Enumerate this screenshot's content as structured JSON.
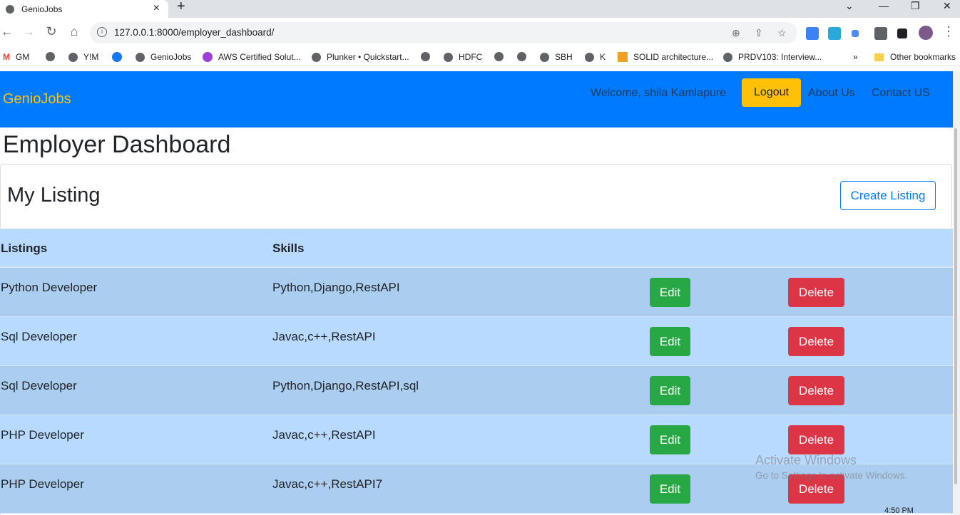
{
  "browser": {
    "tab_title": "GenioJobs",
    "tab_close": "×",
    "new_tab": "+",
    "url": "127.0.0.1:8000/employer_dashboard/",
    "bookmarks": [
      "GM",
      "Y!M",
      "GenioJobs",
      "AWS Certified Solut...",
      "Plunker • Quickstart...",
      "HDFC",
      "SBH",
      "K",
      "SOLID architecture...",
      "PRDV103: Interview..."
    ],
    "more_bookmarks": "»",
    "other_bookmarks": "Other bookmarks"
  },
  "navbar": {
    "brand": "GenioJobs",
    "welcome": "Welcome, shila Kamlapure",
    "logout": "Logout",
    "about": "About Us",
    "contact": "Contact US"
  },
  "page": {
    "title": "Employer Dashboard",
    "section_title": "My Listing",
    "create_button": "Create Listing"
  },
  "table": {
    "headers": [
      "Listings",
      "Skills"
    ],
    "rows": [
      {
        "listing": "Python Developer",
        "skills": "Python,Django,RestAPI",
        "edit": "Edit",
        "delete": "Delete"
      },
      {
        "listing": "Sql Developer",
        "skills": "Javac,c++,RestAPI",
        "edit": "Edit",
        "delete": "Delete"
      },
      {
        "listing": "Sql Developer",
        "skills": "Python,Django,RestAPI,sql",
        "edit": "Edit",
        "delete": "Delete"
      },
      {
        "listing": "PHP Developer",
        "skills": "Javac,c++,RestAPI",
        "edit": "Edit",
        "delete": "Delete"
      },
      {
        "listing": "PHP Developer",
        "skills": "Javac,c++,RestAPI7",
        "edit": "Edit",
        "delete": "Delete"
      }
    ]
  },
  "watermark": {
    "line1": "Activate Windows",
    "line2": "Go to Settings to activate Windows."
  },
  "taskbar": {
    "time": "4:50 PM"
  },
  "colors": {
    "navbar": "#007bff",
    "brand": "#ffc107",
    "edit": "#28a745",
    "delete": "#dc3545",
    "table_row": "#b8daff"
  }
}
